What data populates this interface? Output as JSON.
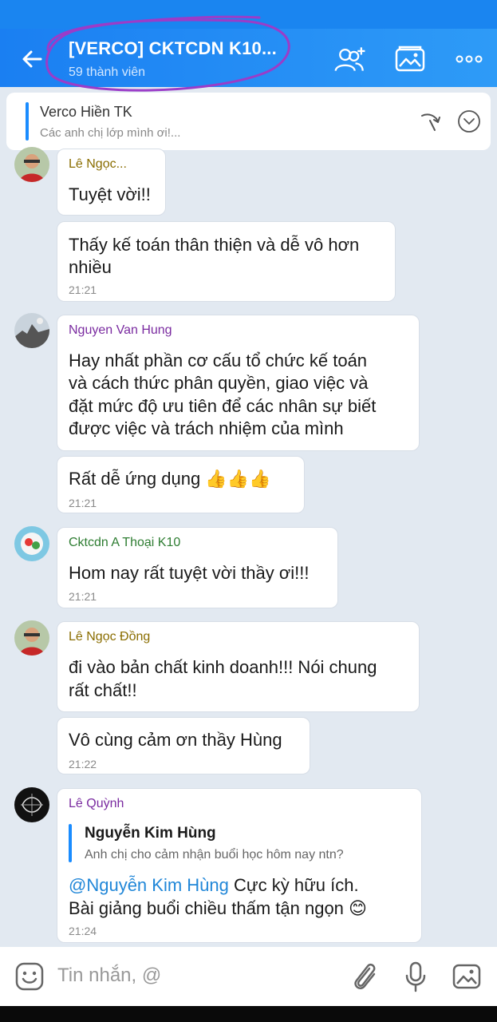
{
  "header": {
    "title": "[VERCO] CKTCDN K10...",
    "subtitle": "59 thành viên",
    "icons": [
      "back-arrow-icon",
      "add-member-icon",
      "gallery-icon",
      "more-icon"
    ]
  },
  "pinned": {
    "name": "Verco Hiền TK",
    "text": "Các anh chị lớp mình ơi!...",
    "icons": [
      "share-icon",
      "chevron-down-icon"
    ]
  },
  "messages": [
    {
      "sender": "Lê Ngọc...",
      "sender_color": "#8a6d00",
      "text": "Tuyệt vời!!"
    },
    {
      "text_line1": "Thấy kế toán thân thiện và dễ vô hơn",
      "text_line2": "nhiều",
      "time": "21:21"
    },
    {
      "sender": "Nguyen Van Hung",
      "sender_color": "#7a2ba0",
      "lines": [
        "Hay nhất phần cơ cấu tổ chức kế toán",
        "và cách thức phân quyền, giao việc và",
        "đặt mức độ ưu tiên để các nhân sự biết",
        "được việc và trách nhiệm của mình"
      ]
    },
    {
      "text": "Rất dễ ứng dụng 👍👍👍",
      "time": "21:21"
    },
    {
      "sender": "Cktcdn A Thoại K10",
      "sender_color": "#2e7d32",
      "text": "Hom nay rất tuyệt vời thầy ơi!!!",
      "time": "21:21"
    },
    {
      "sender": "Lê Ngọc Đồng",
      "sender_color": "#8a6d00",
      "line1": "đi vào bản chất kinh doanh!!! Nói chung",
      "line2": "rất chất!!"
    },
    {
      "text": "Vô cùng cảm ơn thầy Hùng",
      "time": "21:22"
    },
    {
      "sender": "Lê Quỳnh",
      "sender_color": "#7a2ba0",
      "quote_name": "Nguyễn Kim Hùng",
      "quote_text": "Anh chị cho cảm nhận buổi học hôm nay ntn?",
      "mention": "@Nguyễn Kim Hùng",
      "line1_rest": " Cực kỳ hữu ích.",
      "line2": "Bài giảng buổi chiều thấm tận ngọn 😊",
      "time": "21:24"
    }
  ],
  "composer": {
    "placeholder": "Tin nhắn, @",
    "icons": [
      "emoji-icon",
      "attachment-icon",
      "microphone-icon",
      "image-icon"
    ]
  },
  "colors": {
    "header": "#1a7ff2",
    "accent": "#1a8cff",
    "chat_bg": "#e2e9f1",
    "mark": "#9b3cc8"
  }
}
